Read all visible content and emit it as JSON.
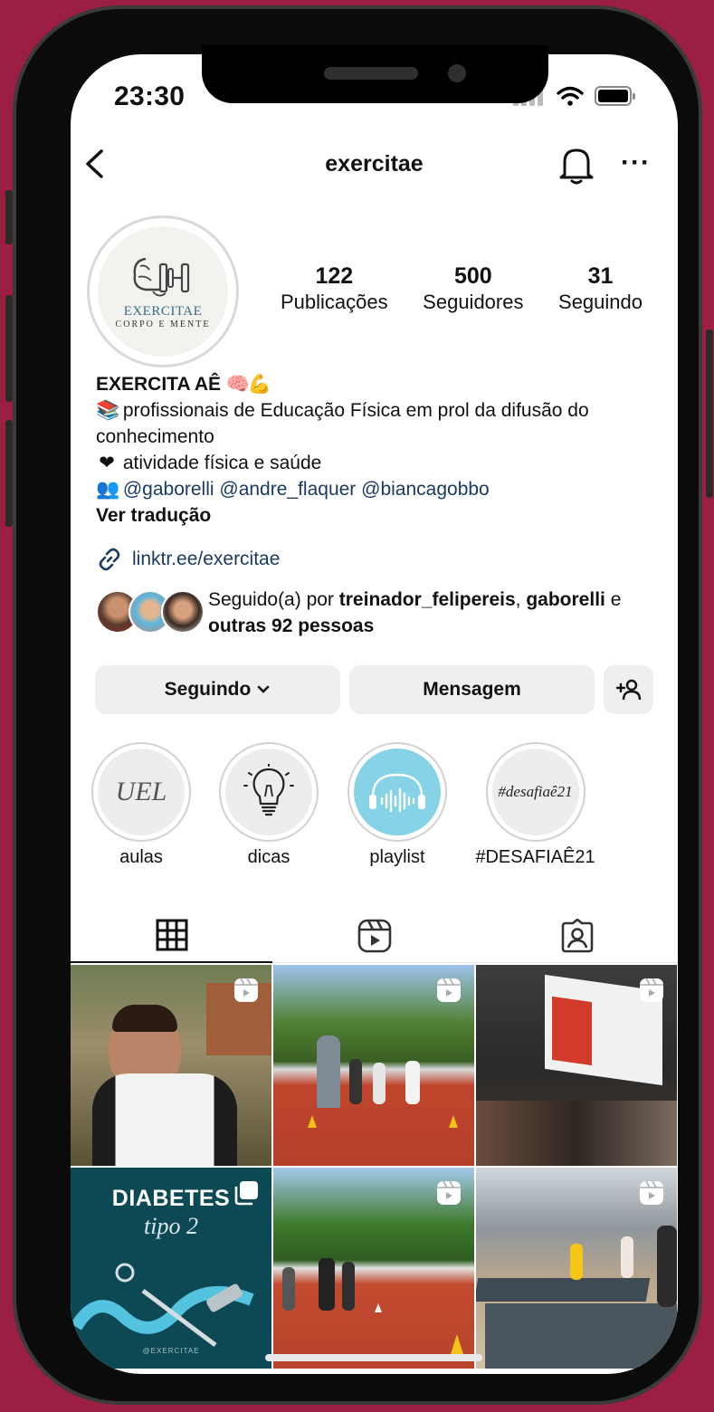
{
  "status": {
    "time": "23:30"
  },
  "header": {
    "username": "exercitae"
  },
  "profile": {
    "avatar_brand": "EXERCITAE",
    "avatar_sub": "CORPO E MENTE",
    "stats": [
      {
        "value": "122",
        "label": "Publicações"
      },
      {
        "value": "500",
        "label": "Seguidores"
      },
      {
        "value": "31",
        "label": "Seguindo"
      }
    ],
    "display_name": "EXERCITA AÊ",
    "bio_line1": "profissionais de Educação Física em prol da difusão do conhecimento",
    "bio_line2": "atividade física e saúde",
    "mentions": "@gaborelli @andre_flaquer @biancagobbo",
    "translate": "Ver tradução",
    "link": "linktr.ee/exercitae",
    "followed_prefix": "Seguido(a) por ",
    "followed_names": "treinador_felipereis",
    "followed_sep": ", ",
    "followed_name2": "gaborelli",
    "followed_mid": " e ",
    "followed_others": "outras 92 pessoas"
  },
  "actions": {
    "following": "Seguindo",
    "message": "Mensagem"
  },
  "highlights": [
    {
      "label": "aulas",
      "cover": "UEL"
    },
    {
      "label": "dicas",
      "cover": ""
    },
    {
      "label": "playlist",
      "cover": ""
    },
    {
      "label": "#DESAFIAÊ21",
      "cover": "#desafiaê21"
    }
  ],
  "grid": {
    "post4_title": "DIABETES",
    "post4_sub": "tipo 2",
    "post4_handle": "@EXERCITAE"
  },
  "colors": {
    "background": "#9b1f42",
    "link": "#1b3a63",
    "button": "#efefef"
  }
}
